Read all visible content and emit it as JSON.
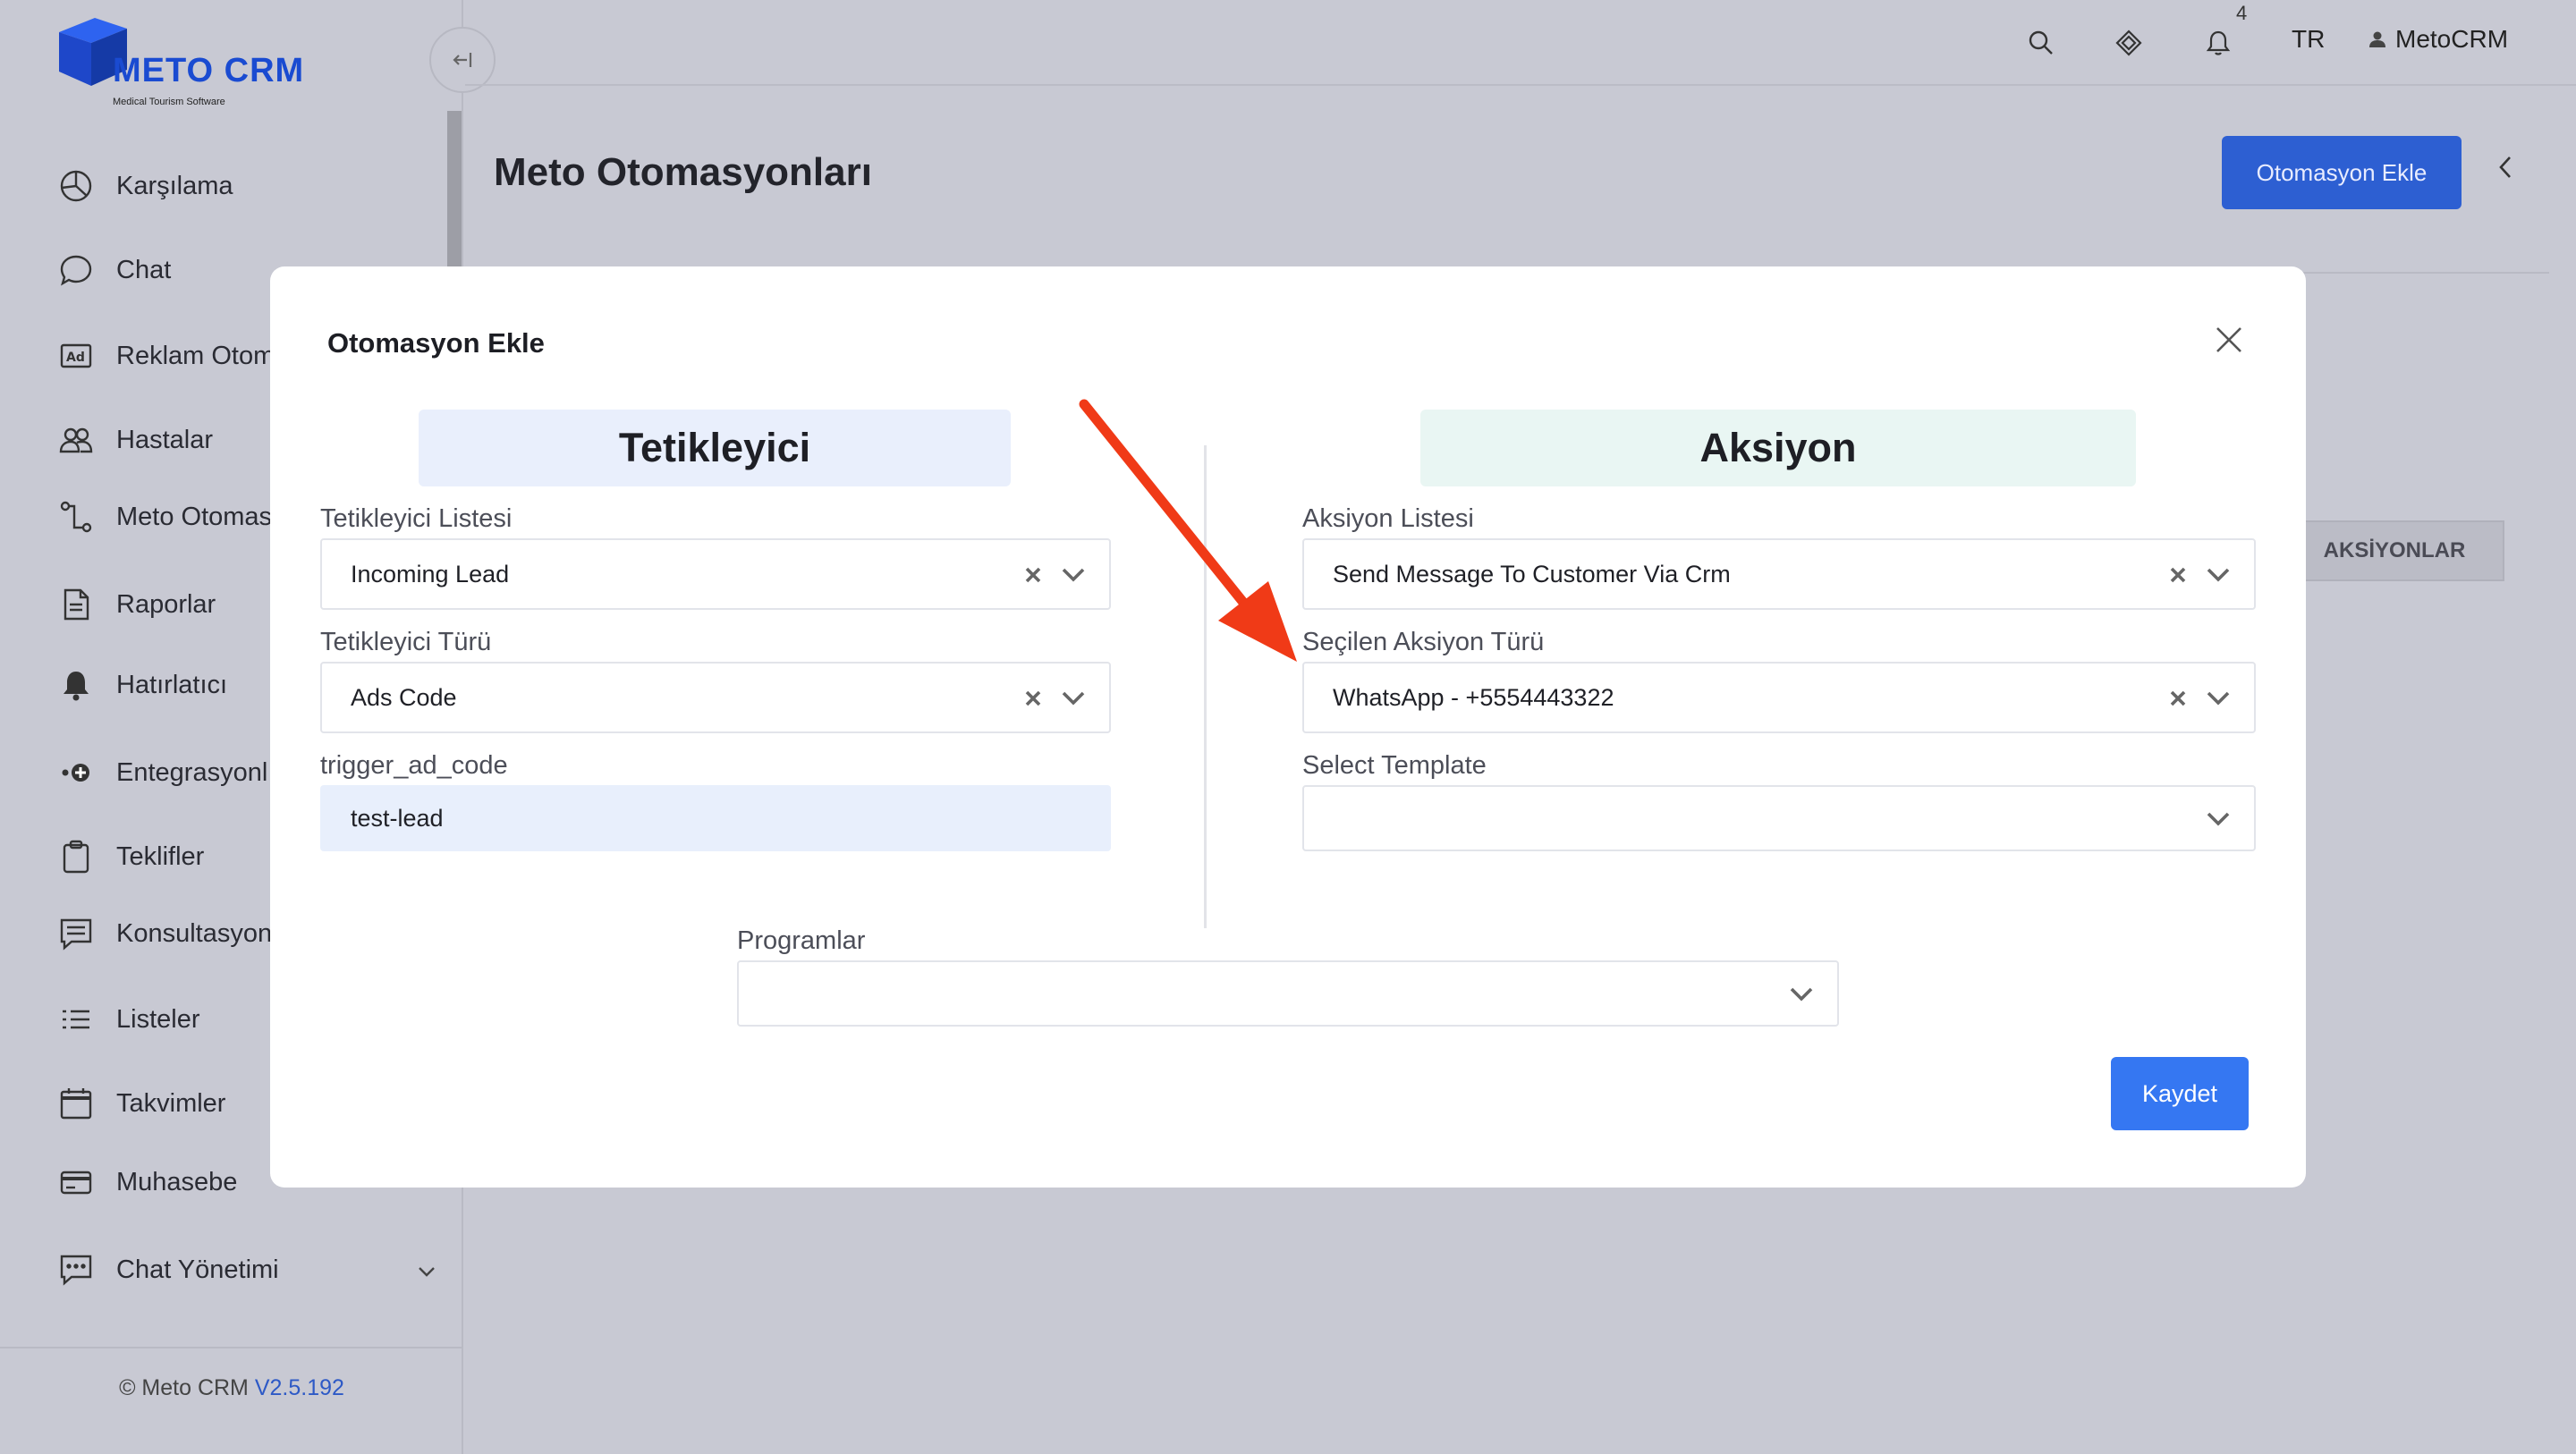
{
  "brand": {
    "name": "METO CRM",
    "tagline": "Medical Tourism Software",
    "primary_color": "#1a4bd1"
  },
  "sidebar": {
    "items": [
      {
        "label": "Karşılama",
        "icon": "dashboard-icon"
      },
      {
        "label": "Chat",
        "icon": "chat-bubble-icon"
      },
      {
        "label": "Reklam Otom",
        "icon": "ad-icon"
      },
      {
        "label": "Hastalar",
        "icon": "users-icon"
      },
      {
        "label": "Meto Otomas",
        "icon": "flow-icon"
      },
      {
        "label": "Raporlar",
        "icon": "report-icon"
      },
      {
        "label": "Hatırlatıcı",
        "icon": "bell-icon"
      },
      {
        "label": "Entegrasyonl",
        "icon": "integration-icon"
      },
      {
        "label": "Teklifler",
        "icon": "clipboard-icon"
      },
      {
        "label": "Konsultasyon",
        "icon": "message-list-icon"
      },
      {
        "label": "Listeler",
        "icon": "list-icon"
      },
      {
        "label": "Takvimler",
        "icon": "calendar-icon"
      },
      {
        "label": "Muhasebe",
        "icon": "card-icon"
      },
      {
        "label": "Chat Yönetimi",
        "icon": "chat-manage-icon"
      }
    ],
    "footer_prefix": "© Meto CRM",
    "footer_version": "V2.5.192"
  },
  "header": {
    "notification_count": "4",
    "language": "TR",
    "user": "MetoCRM"
  },
  "page": {
    "title": "Meto Otomasyonları",
    "add_button": "Otomasyon Ekle",
    "tab_actions": "AKSİYONLAR"
  },
  "modal": {
    "title": "Otomasyon Ekle",
    "trigger": {
      "heading": "Tetikleyici",
      "list_label": "Tetikleyici Listesi",
      "list_value": "Incoming Lead",
      "type_label": "Tetikleyici Türü",
      "type_value": "Ads Code",
      "code_label": "trigger_ad_code",
      "code_value": "test-lead"
    },
    "action": {
      "heading": "Aksiyon",
      "list_label": "Aksiyon Listesi",
      "list_value": "Send Message To Customer Via Crm",
      "type_label": "Seçilen Aksiyon Türü",
      "type_value": "WhatsApp - +5554443322",
      "template_label": "Select Template",
      "template_value": ""
    },
    "programs_label": "Programlar",
    "programs_value": "",
    "save_button": "Kaydet"
  },
  "annotation": {
    "arrow_color": "#f03a17"
  }
}
